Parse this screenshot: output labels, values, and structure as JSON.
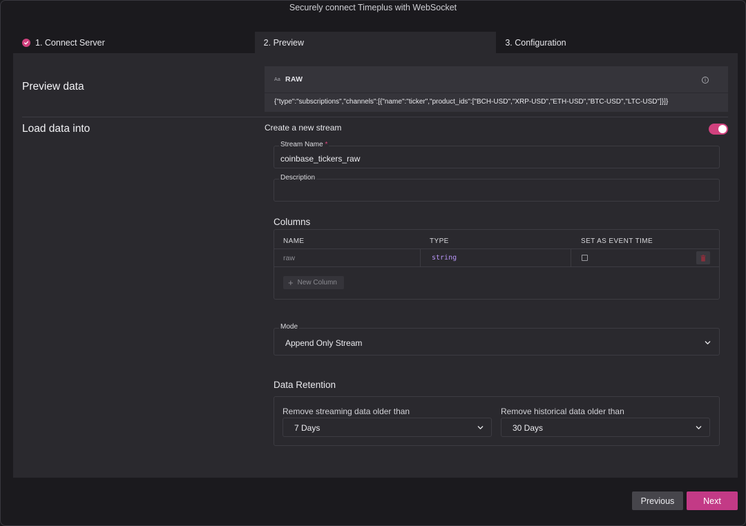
{
  "dialog": {
    "title": "Securely connect Timeplus with WebSocket"
  },
  "tabs": [
    {
      "label": "1. Connect Server",
      "completed": true
    },
    {
      "label": "2. Preview",
      "active": true
    },
    {
      "label": "3. Configuration"
    }
  ],
  "preview": {
    "section_label": "Preview data",
    "format_icon": "Aa",
    "format_label": "RAW",
    "data": "{\"type\":\"subscriptions\",\"channels\":[{\"name\":\"ticker\",\"product_ids\":[\"BCH-USD\",\"XRP-USD\",\"ETH-USD\",\"BTC-USD\",\"LTC-USD\"]}]}"
  },
  "load": {
    "section_label": "Load data into",
    "create_label": "Create a new stream",
    "create_enabled": true,
    "stream_name_label": "Stream Name",
    "required_mark": "*",
    "stream_name_value": "coinbase_tickers_raw",
    "description_label": "Description",
    "description_value": ""
  },
  "columns": {
    "heading": "Columns",
    "headers": [
      "NAME",
      "TYPE",
      "SET AS EVENT TIME"
    ],
    "rows": [
      {
        "name": "raw",
        "type": "string",
        "event_time": false
      }
    ],
    "new_column_label": "New Column"
  },
  "mode": {
    "label": "Mode",
    "value": "Append Only Stream"
  },
  "retention": {
    "heading": "Data Retention",
    "streaming_label": "Remove streaming data older than",
    "streaming_value": "7 Days",
    "historical_label": "Remove historical data older than",
    "historical_value": "30 Days"
  },
  "footer": {
    "previous_label": "Previous",
    "next_label": "Next"
  },
  "colors": {
    "accent": "#d1417e",
    "next_button": "#c33a86",
    "type_text": "#b794f6"
  }
}
